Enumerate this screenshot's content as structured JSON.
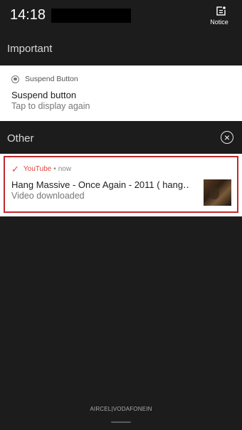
{
  "status_bar": {
    "time": "14:18",
    "notice_label": "Notice",
    "notice_icon": "notice-icon"
  },
  "sections": {
    "important": "Important",
    "other": "Other"
  },
  "suspend_notification": {
    "app_name": "Suspend Button",
    "app_icon": "radio-button-icon",
    "title": "Suspend button",
    "subtitle": "Tap to display again"
  },
  "youtube_notification": {
    "app_name": "YouTube",
    "app_icon": "checkmark-icon",
    "separator": "•",
    "time": "now",
    "title": "Hang Massive - Once Again - 2011 ( hang‥",
    "subtitle": "Video downloaded",
    "accent_color": "#e1453a",
    "highlight_color": "#c0292e"
  },
  "clear_icon": "close-circle-icon",
  "footer": {
    "carrier": "AIRCEL|VODAFONEIN"
  },
  "colors": {
    "background": "#1c1c1c",
    "card": "#ffffff"
  }
}
